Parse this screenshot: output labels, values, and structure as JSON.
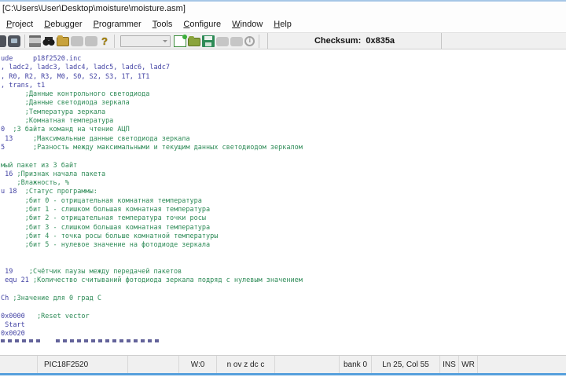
{
  "window": {
    "title": "[C:\\Users\\User\\Desktop\\moisture\\moisture.asm]",
    "top_border_color": "#a6c6e6",
    "bottom_border_color": "#57a0dc"
  },
  "menu": {
    "items": [
      "Project",
      "Debugger",
      "Programmer",
      "Tools",
      "Configure",
      "Window",
      "Help"
    ]
  },
  "toolbar": {
    "checksum": "Checksum:  0x835a",
    "combobox_value": "",
    "groups": [
      [
        "window-partial-icon",
        "paste-icon"
      ],
      [
        "print-icon",
        "find-icon",
        "folder-icon",
        "stamp-icon-1",
        "stamp-icon-2",
        "help-icon"
      ],
      [
        "project-combobox",
        "new-file-icon",
        "open-file-icon",
        "save-icon",
        "program-icon",
        "read-icon",
        "info-icon"
      ]
    ]
  },
  "editor": {
    "colors": {
      "code": "#4343a4",
      "comment": "#2e8b57"
    },
    "lines": [
      {
        "c": "ude     p18f2520.inc",
        "m": ""
      },
      {
        "c": ", ladc2, ladc3, ladc4, ladc5, ladc6, ladc7",
        "m": ""
      },
      {
        "c": ", R0, R2, R3, M0, S0, S2, S3, 1T, 1T1",
        "m": ""
      },
      {
        "c": ", trans, t1",
        "m": ""
      },
      {
        "c": "      ",
        "m": ";Данные контрольного светодиода"
      },
      {
        "c": "      ",
        "m": ";Данные светодиода зеркала"
      },
      {
        "c": "      ",
        "m": ";Температура зеркала"
      },
      {
        "c": "      ",
        "m": ";Комнатная температура"
      },
      {
        "c": "0  ",
        "m": ";3 байта команд на чтение АЦП"
      },
      {
        "c": " 13     ",
        "m": ";Максимальные данные светодиода зеркала"
      },
      {
        "c": "5       ",
        "m": ";Разность между максимальными и текущим данных светодиодом зеркалом"
      },
      {
        "c": "",
        "m": ""
      },
      {
        "c": "",
        "m": "мый пакет из 3 байт"
      },
      {
        "c": " 16 ",
        "m": ";Признак начала пакета"
      },
      {
        "c": "    ",
        "m": ";Влажность, %"
      },
      {
        "c": "u 18  ",
        "m": ";Статус программы:"
      },
      {
        "c": "      ",
        "m": ";бит 0 - отрицательная комнатная температура"
      },
      {
        "c": "      ",
        "m": ";бит 1 - слишком большая комнатная температура"
      },
      {
        "c": "      ",
        "m": ";бит 2 - отрицательная температура точки росы"
      },
      {
        "c": "      ",
        "m": ";бит 3 - слишком большая комнатная температура"
      },
      {
        "c": "      ",
        "m": ";бит 4 - точка росы больше комнатной температуры"
      },
      {
        "c": "      ",
        "m": ";бит 5 - нулевое значение на фотодиоде зеркала"
      },
      {
        "c": "",
        "m": ""
      },
      {
        "c": "",
        "m": ""
      },
      {
        "c": " 19    ",
        "m": ";Счётчик паузы между передачей пакетов"
      },
      {
        "c": " equ 21 ",
        "m": ";Количество считываний фотодиода зеркала подряд с нулевым значением"
      },
      {
        "c": "",
        "m": ""
      },
      {
        "c": "Ch ",
        "m": ";Значение для 0 град С"
      },
      {
        "c": "",
        "m": ""
      },
      {
        "c": "0x0000   ",
        "m": ";Reset vector"
      },
      {
        "c": " Start",
        "m": ""
      },
      {
        "c": "0x0020",
        "m": ""
      },
      {
        "clipped": true,
        "c": "",
        "m": ""
      }
    ]
  },
  "status": {
    "cells": [
      "",
      "PIC18F2520",
      "",
      "W:0",
      "n ov z dc c",
      "",
      "bank 0",
      "Ln 25, Col 55",
      "INS",
      "WR",
      ""
    ]
  }
}
